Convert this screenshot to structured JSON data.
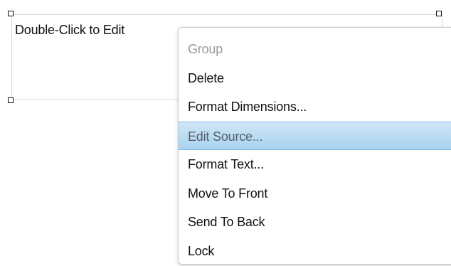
{
  "textbox": {
    "text": "Double-Click to Edit"
  },
  "context_menu": {
    "items": [
      {
        "label": "Group",
        "state": "disabled"
      },
      {
        "label": "Delete",
        "state": "normal"
      },
      {
        "label": "Format Dimensions...",
        "state": "normal"
      },
      {
        "label": "Edit Source...",
        "state": "highlighted"
      },
      {
        "label": "Format Text...",
        "state": "normal"
      },
      {
        "label": "Move To Front",
        "state": "normal"
      },
      {
        "label": "Send To Back",
        "state": "normal"
      },
      {
        "label": "Lock",
        "state": "normal"
      }
    ]
  },
  "colors": {
    "highlight": "#a9d2f0",
    "disabled_text": "#9a9a9a",
    "text": "#111111"
  }
}
